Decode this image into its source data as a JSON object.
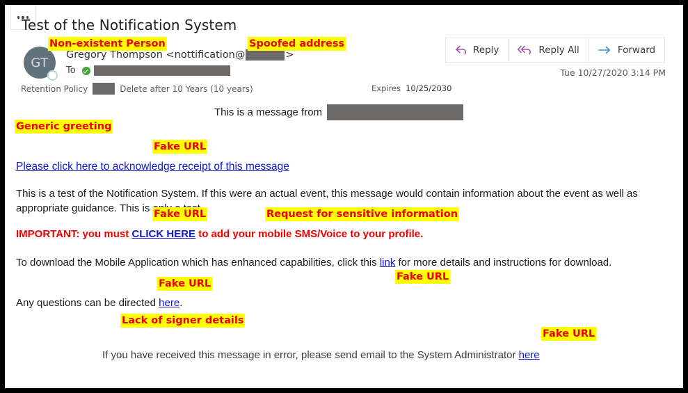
{
  "window": {
    "border_color": "#000000",
    "background": "#ffffff"
  },
  "email": {
    "subject": "Test of the Notification System",
    "avatar_initials": "GT",
    "sender_prefix": "Gregory Thompson <nottification@",
    "sender_suffix": ">",
    "to_label": "To",
    "retention_label": "Retention Policy",
    "retention_value": "Delete after 10 Years (10 years)",
    "expires_label": "Expires",
    "expires_date": "10/25/2030",
    "timestamp": "Tue 10/27/2020 3:14 PM"
  },
  "actions": {
    "reply": "Reply",
    "reply_all": "Reply All",
    "forward": "Forward",
    "reply_icon_color": "#a64ca6",
    "forward_icon_color": "#3d8fd1"
  },
  "body": {
    "greeting": "This is a message from",
    "ack_link": "Please click here to acknowledge receipt of this message",
    "paragraph1": "This is a test of the Notification System. If this were an actual event, this message would contain information about the event as well as appropriate guidance. This is only a test.",
    "important_prefix": "IMPORTANT: you must ",
    "important_link": "CLICK HERE",
    "important_suffix": " to add your mobile SMS/Voice to your profile.",
    "paragraph2_prefix": "To download the Mobile Application which has enhanced capabilities, click this ",
    "paragraph2_link": "link",
    "paragraph2_suffix": " for more details and instructions for download.",
    "paragraph3_prefix": "Any questions can be directed ",
    "paragraph3_link": "here",
    "paragraph3_suffix": ".",
    "footer_prefix": "If you have received this message in error, please send email to the System Administrator ",
    "footer_link": "here"
  },
  "annotations": {
    "highlight_color": "#ffff00",
    "text_color": "#ee0000",
    "items": [
      {
        "label": "Non-existent Person"
      },
      {
        "label": "Spoofed address"
      },
      {
        "label": "Generic greeting"
      },
      {
        "label": "Fake URL"
      },
      {
        "label": "Fake URL"
      },
      {
        "label": "Request for sensitive information"
      },
      {
        "label": "Fake URL"
      },
      {
        "label": "Fake URL"
      },
      {
        "label": "Lack of signer details"
      },
      {
        "label": "Fake URL"
      }
    ]
  }
}
